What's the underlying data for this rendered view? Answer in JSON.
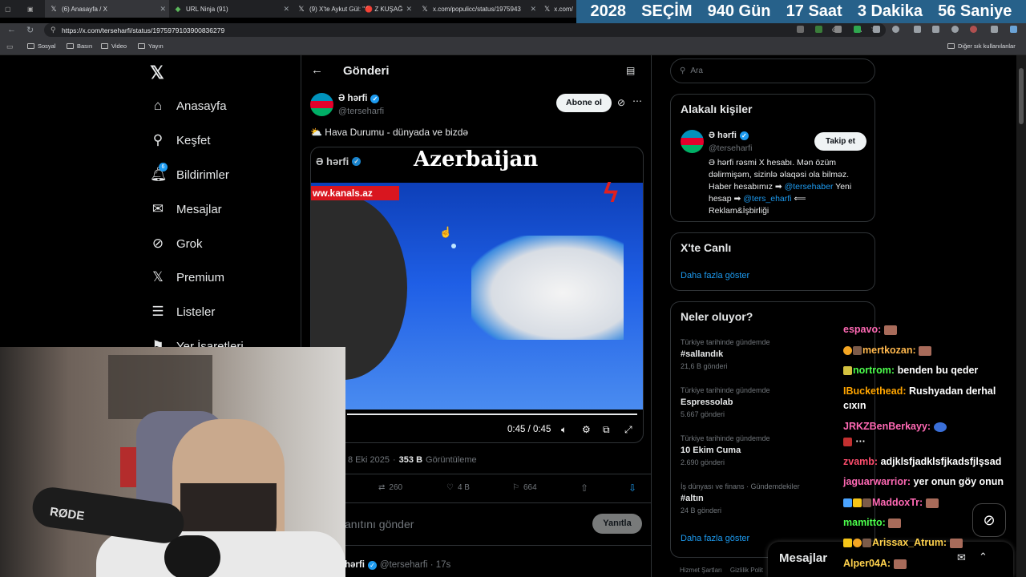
{
  "browser": {
    "tabs": [
      {
        "label": "(6) Anasayfa / X"
      },
      {
        "label": "URL Ninja (91)"
      },
      {
        "label": "(9) X'te Aykut Gül: \"🔴 Z KUŞAĞ"
      },
      {
        "label": "x.com/populicc/status/1975943"
      },
      {
        "label": "x.com/"
      }
    ],
    "url": "https://x.com/terseharfi/status/1975979103900836279",
    "bookmarks": [
      "Sosyal",
      "Basın",
      "Video",
      "Yayın"
    ],
    "other_bookmarks": "Diğer sık kullanılanlar"
  },
  "countdown": {
    "year": "2028",
    "label": "SEÇİM",
    "days": "940 Gün",
    "hours": "17 Saat",
    "minutes": "3  Dakika",
    "seconds": "56 Saniye"
  },
  "nav": {
    "items": [
      {
        "label": "Anasayfa",
        "icon": "home-icon"
      },
      {
        "label": "Keşfet",
        "icon": "search-icon"
      },
      {
        "label": "Bildirimler",
        "icon": "bell-icon"
      },
      {
        "label": "Mesajlar",
        "icon": "mail-icon"
      },
      {
        "label": "Grok",
        "icon": "grok-icon"
      },
      {
        "label": "Premium",
        "icon": "x-logo-icon"
      },
      {
        "label": "Listeler",
        "icon": "list-icon"
      },
      {
        "label": "Yer İşaretleri",
        "icon": "bookmark-icon"
      }
    ],
    "notification_count": "6"
  },
  "post": {
    "header_title": "Gönderi",
    "author_name": "Ə hərfi",
    "author_handle": "@terseharfi",
    "subscribe_label": "Abone ol",
    "text": "⛅ Hava Durumu - dünyada ve bizdə",
    "video": {
      "title": "Azerbaijan",
      "watermark_name": "Ə hərfi",
      "ticker": "ww.kanals.az",
      "time": "0:45 / 0:45"
    },
    "meta_date": "8 Eki 2025",
    "meta_views": "353 B",
    "meta_views_label": "Görüntüleme",
    "retweets": "260",
    "likes": "4 B",
    "bookmarks": "664",
    "reply_placeholder": "anıtını gönder",
    "reply_button": "Yanıtla",
    "reply_author": "hərfi",
    "reply_handle": "@terseharfi · 17s"
  },
  "search": {
    "placeholder": "Ara"
  },
  "related": {
    "title": "Alakalı kişiler",
    "name": "Ə hərfi",
    "handle": "@terseharfi",
    "follow_label": "Takip et",
    "bio_1": "Ə hərfi rəsmi X hesabı. Mən özüm",
    "bio_2": "dəlirmişəm, sizinlə əlaqəsi ola bilməz.",
    "bio_3": "Haber hesabımız ➡",
    "bio_link1": "@tersehaber",
    "bio_4": " Yeni",
    "bio_5": "hesap ➡",
    "bio_link2": "@ters_eharfi",
    "bio_6": " ⟸",
    "bio_7": "Reklam&İşbirliği"
  },
  "live": {
    "title": "X'te Canlı",
    "more": "Daha fazla göster"
  },
  "trends": {
    "title": "Neler oluyor?",
    "items": [
      {
        "category": "Türkiye tarihinde gündemde",
        "title": "#sallandık",
        "count": "21,6 B gönderi"
      },
      {
        "category": "Türkiye tarihinde gündemde",
        "title": "Espressolab",
        "count": "5.667 gönderi"
      },
      {
        "category": "Türkiye tarihinde gündemde",
        "title": "10 Ekim Cuma",
        "count": "2.690 gönderi"
      },
      {
        "category": "İş dünyası ve finans · Gündemdekiler",
        "title": "#altın",
        "count": "24 B gönderi"
      }
    ],
    "more": "Daha fazla göster"
  },
  "footer": {
    "terms": "Hizmet Şartları",
    "privacy": "Gizlilik Polit"
  },
  "messages_dock": {
    "label": "Mesajlar"
  },
  "chat": [
    {
      "user": "espavo:",
      "color": "#ff69b4",
      "msg": ""
    },
    {
      "user": "mertkozan:",
      "color": "#ffb84d",
      "msg": ""
    },
    {
      "user": "nortrom:",
      "color": "#4cff4c",
      "msg": "benden bu qeder"
    },
    {
      "user": "IBuckethead:",
      "color": "#ffa500",
      "msg": "Rushyadan derhal"
    },
    {
      "user": "",
      "color": "#fff",
      "msg": "cıxın"
    },
    {
      "user": "JRKZBenBerkayy:",
      "color": "#ff69b4",
      "msg": ""
    },
    {
      "user": "zvamb:",
      "color": "#ff4d6d",
      "msg": "adjklsfjadklsfjkadsfjlşsad"
    },
    {
      "user": "jaguarwarrior:",
      "color": "#ff69b4",
      "msg": "yer onun göy onun"
    },
    {
      "user": "MaddoxTr:",
      "color": "#ff69b4",
      "msg": ""
    },
    {
      "user": "mamitto:",
      "color": "#4cff4c",
      "msg": ""
    },
    {
      "user": "Arissax_Atrum:",
      "color": "#ffd24d",
      "msg": ""
    },
    {
      "user": "Alper04A:",
      "color": "#ffd24d",
      "msg": ""
    }
  ],
  "webcam": {
    "mic_brand": "RØDE"
  },
  "colors": {
    "accent": "#1d9bf0",
    "countdown_bg": "#27618a",
    "bg": "#000000",
    "border": "#2f3336"
  }
}
